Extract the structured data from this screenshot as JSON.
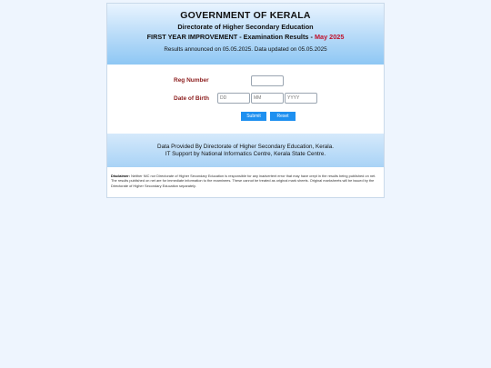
{
  "header": {
    "title": "GOVERNMENT OF KERALA",
    "subtitle": "Directorate of Higher Secondary Education",
    "exam_prefix": "FIRST YEAR IMPROVEMENT - Examination Results - ",
    "exam_session": "May 2025",
    "announcement": "Results announced on 05.05.2025. Data updated on 05.05.2025"
  },
  "form": {
    "reg_label": "Reg Number",
    "reg_value": "",
    "dob_label": "Date of Birth",
    "dd_placeholder": "DD",
    "mm_placeholder": "MM",
    "yyyy_placeholder": "YYYY",
    "submit_label": "Submit",
    "reset_label": "Reset"
  },
  "footer": {
    "line1": "Data Provided By Directorate of Higher Secondary Education, Kerala.",
    "line2": "IT Support by National Informatics Centre, Kerala State Centre."
  },
  "disclaimer": {
    "label": "Disclaimer:",
    "text": " Neither NIC nor Directorate of Higher Secondary Education is responsible for any inadvertent error that may have crept in the results being published on net. The results published on net are for immediate information to the examinees. These cannot be treated as original mark sheets. Original marksheets will be issued by the Directorate of Higher Secondary Education separately."
  },
  "colors": {
    "page_bg": "#eef5fe",
    "accent_red": "#c0102a",
    "label_maroon": "#8c1d1d",
    "button_blue": "#1e90f0"
  }
}
